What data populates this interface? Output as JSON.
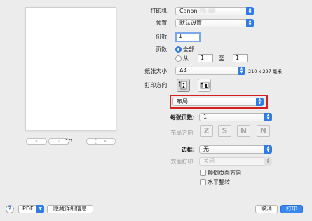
{
  "preview": {
    "first_label": "«",
    "prev_label": "‹",
    "page_indicator": "1/1",
    "next_label": "›",
    "last_label": "»"
  },
  "printer": {
    "label": "打印机:",
    "value": "Canon",
    "value_blurred": "TS 00"
  },
  "presets": {
    "label": "预置:",
    "value": "默认设置"
  },
  "copies": {
    "label": "份数:",
    "value": "1"
  },
  "pages": {
    "label": "页数:",
    "all_label": "全部",
    "from_label": "从:",
    "from_value": "1",
    "to_label": "至:",
    "to_value": "1",
    "selected": "all"
  },
  "paper_size": {
    "label": "纸张大小:",
    "value": "A4",
    "dimensions": "210 x 297 毫米"
  },
  "orientation": {
    "label": "打印方向:",
    "selected": "portrait"
  },
  "section": {
    "value": "布局"
  },
  "pages_per_sheet": {
    "label": "每张页数:",
    "value": "1"
  },
  "layout_direction": {
    "label": "布局方向:",
    "icons": [
      "Z",
      "S",
      "N",
      "N"
    ]
  },
  "border": {
    "label": "边框:",
    "value": "无"
  },
  "two_sided": {
    "label": "双面打印:",
    "value": "关闭"
  },
  "reverse_orientation": {
    "label": "颠倒页面方向",
    "checked": false
  },
  "flip_horizontal": {
    "label": "水平翻转",
    "checked": false
  },
  "footer": {
    "help_label": "?",
    "pdf_label": "PDF",
    "hide_details_label": "隐藏详细信息",
    "cancel_label": "取消",
    "print_label": "打印"
  },
  "colors": {
    "accent": "#2f7be8",
    "highlight_border": "#d62020"
  }
}
